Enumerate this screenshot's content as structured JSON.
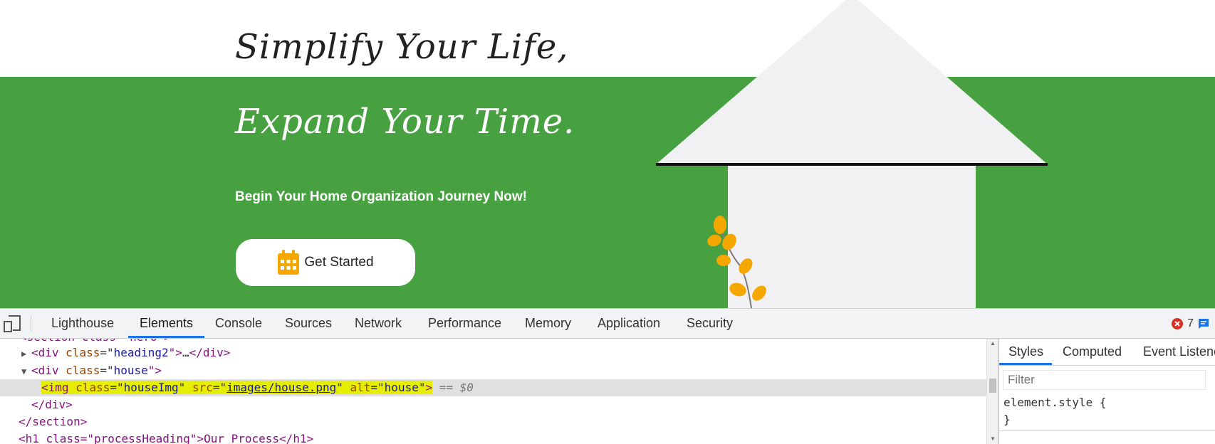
{
  "hero": {
    "heading_line1": "Simplify Your Life,",
    "heading_line2": "Expand Your Time.",
    "subheading": "Begin Your Home Organization Journey Now!",
    "cta_label": "Get Started",
    "cta_icon": "calendar-icon",
    "decor_icons": [
      "house-illustration",
      "plant-icon"
    ]
  },
  "colors": {
    "green": "#47a141",
    "house": "#f1f1f3",
    "leaf": "#f5a700",
    "selection_highlight": "#e6ee00",
    "devtools_accent": "#1a73e8"
  },
  "devtools": {
    "tabs": [
      "Lighthouse",
      "Elements",
      "Console",
      "Sources",
      "Network",
      "Performance",
      "Memory",
      "Application",
      "Security"
    ],
    "active_tab": "Elements",
    "error_count": "7",
    "dom": {
      "line0": "<section class=\"hero\">",
      "line1": {
        "open": "<div ",
        "attr": "class",
        "eq": "=\"",
        "val": "heading2",
        "close": "\">",
        "ellipsis": "…",
        "end": "</div>"
      },
      "line2": {
        "open": "<div ",
        "attr": "class",
        "eq": "=\"",
        "val": "house",
        "close": "\">"
      },
      "line3": {
        "tag": "<img ",
        "a1": "class",
        "v1": "houseImg",
        "a2": "src",
        "v2": "images/house.png",
        "a3": "alt",
        "v3": "house",
        "close": ">",
        "suffix": " == $0"
      },
      "line4": "</div>",
      "line5": "</section>",
      "line6": "<h1 class=\"processHeading\">Our Process</h1>"
    },
    "styles_panel": {
      "tabs": [
        "Styles",
        "Computed",
        "Event Listeners"
      ],
      "filter_placeholder": "Filter",
      "element_style_open": "element.style {",
      "element_style_close": "}"
    }
  }
}
